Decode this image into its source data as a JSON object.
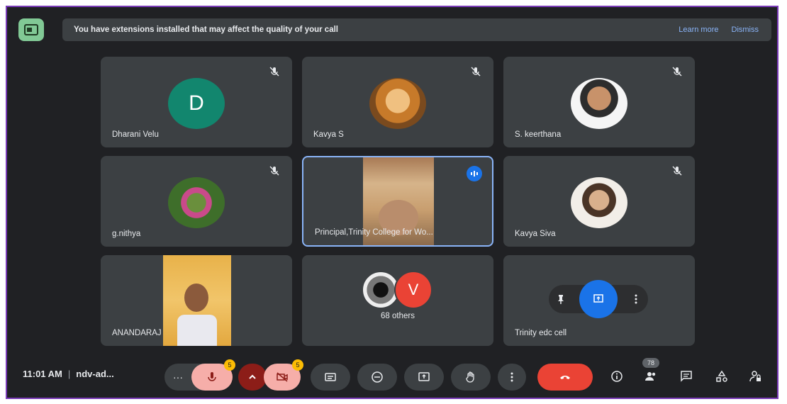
{
  "banner": {
    "message": "You have extensions installed that may affect the quality of your call",
    "learn_more": "Learn more",
    "dismiss": "Dismiss"
  },
  "tiles": [
    {
      "name": "Dharani Velu",
      "avatar_letter": "D"
    },
    {
      "name": "Kavya S"
    },
    {
      "name": "S. keerthana"
    },
    {
      "name": "g.nithya"
    },
    {
      "name": "Principal,Trinity College for Wo..."
    },
    {
      "name": "Kavya Siva"
    },
    {
      "name": "ANANDARAJ"
    },
    {
      "name": "68 others",
      "avatar_letter": "V"
    },
    {
      "name": "Trinity edc cell"
    }
  ],
  "bottom_bar": {
    "time": "11:01 AM",
    "meeting_code": "ndv-ad...",
    "mic_badge": "5",
    "cam_badge": "5",
    "people_count": "78"
  },
  "colors": {
    "background": "#202124",
    "tile": "#3c4043",
    "accent_blue": "#1a73e8",
    "end_call_red": "#ea4335",
    "banner_link": "#8ab4f8"
  }
}
